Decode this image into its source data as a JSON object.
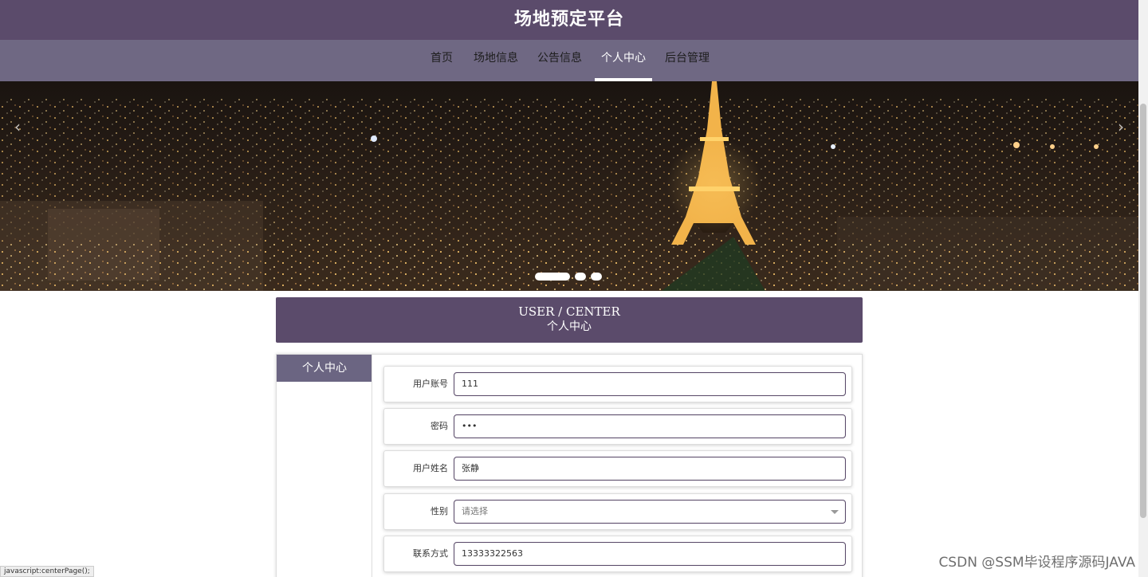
{
  "header": {
    "title": "场地预定平台"
  },
  "nav": {
    "items": [
      {
        "label": "首页"
      },
      {
        "label": "场地信息"
      },
      {
        "label": "公告信息"
      },
      {
        "label": "个人中心"
      },
      {
        "label": "后台管理"
      }
    ],
    "active_index": 3
  },
  "banner": {
    "prev_icon": "chevron-left-icon",
    "next_icon": "chevron-right-icon",
    "slides_count": 3,
    "active_slide": 1
  },
  "section": {
    "title_en": "USER / CENTER",
    "title_cn": "个人中心"
  },
  "sidebar": {
    "tab_label": "个人中心"
  },
  "form": {
    "account_label": "用户账号",
    "account_value": "111",
    "password_label": "密码",
    "password_value": "•••",
    "name_label": "用户姓名",
    "name_value": "张静",
    "gender_label": "性别",
    "gender_placeholder": "请选择",
    "phone_label": "联系方式",
    "phone_value": "13333322563"
  },
  "statusbar": {
    "text": "javascript:centerPage();"
  },
  "watermark": {
    "text": "CSDN @SSM毕设程序源码JAVA"
  },
  "colors": {
    "primary": "#5b4b6b",
    "nav_bg": "#6f6883",
    "tab_bg": "#6b6582"
  }
}
